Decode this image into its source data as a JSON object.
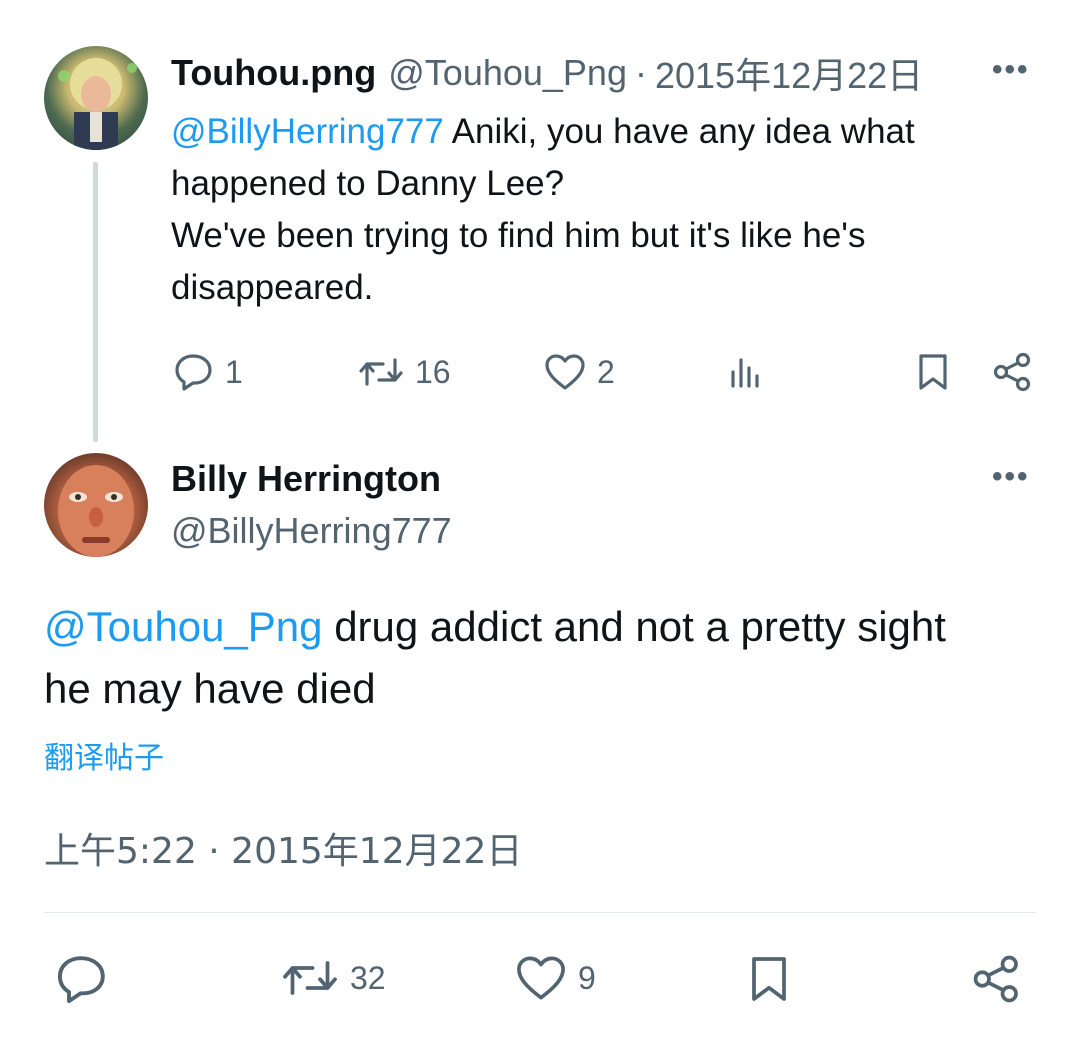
{
  "parent_tweet": {
    "display_name": "Touhou.png",
    "handle": "@Touhou_Png",
    "separator": "·",
    "date": "2015年12月22日",
    "more": "•••",
    "mention": "@BillyHerring777",
    "text_line1": " Aniki, you have any idea what",
    "text_line2": "happened to Danny Lee?",
    "text_line3": "We've been trying to find him but it's like he's",
    "text_line4": "disappeared.",
    "replies": "1",
    "reposts": "16",
    "likes": "2"
  },
  "main_tweet": {
    "display_name": "Billy Herrington",
    "handle": "@BillyHerring777",
    "more": "•••",
    "mention": "@Touhou_Png",
    "text_line1": " drug addict and not a pretty sight",
    "text_line2": "he may have died",
    "translate_link": "翻译帖子",
    "timestamp": "上午5:22 · 2015年12月22日",
    "reposts": "32",
    "likes": "9"
  },
  "colors": {
    "accent": "#1d9bf0",
    "secondary_text": "#536471",
    "primary_text": "#0f1419",
    "thread_line": "#cfd9de"
  },
  "icons": [
    "reply-icon",
    "repost-icon",
    "like-icon",
    "views-icon",
    "bookmark-icon",
    "share-icon",
    "more-icon"
  ]
}
